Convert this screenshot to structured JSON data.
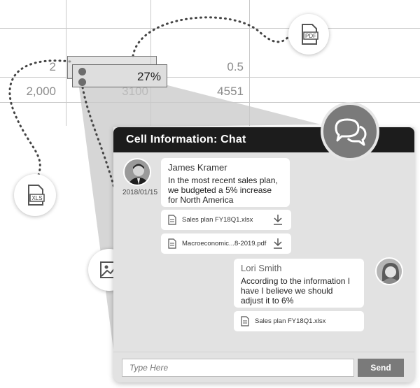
{
  "spreadsheet": {
    "cells": [
      "2",
      "0.5",
      "2,000",
      "3100",
      "4551"
    ],
    "selected_value": "27%"
  },
  "badges": {
    "pdf_label": "PDF",
    "xls_label": "XLS"
  },
  "chat": {
    "title": "Cell Information: Chat",
    "messages": [
      {
        "author": "James Kramer",
        "date": "2018/01/15",
        "text": "In the most recent sales plan, we budgeted a 5% increase for North America",
        "attachments": [
          "Sales plan FY18Q1.xlsx",
          "Macroeconomic...8-2019.pdf"
        ]
      },
      {
        "author": "Lori Smith",
        "text": "According to the information I have I believe we should adjust it to 6%",
        "attachments": [
          "Sales plan FY18Q1.xlsx"
        ]
      }
    ],
    "input_placeholder": "Type Here",
    "send_label": "Send"
  }
}
